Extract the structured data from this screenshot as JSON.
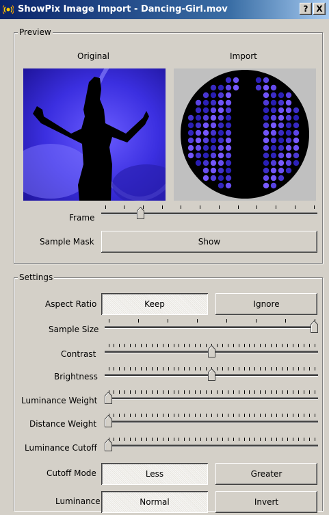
{
  "window": {
    "title": "ShowPix Image Import - Dancing-Girl.mov",
    "help_label": "?",
    "close_label": "X"
  },
  "preview": {
    "legend": "Preview",
    "original_label": "Original",
    "import_label": "Import",
    "frame_label": "Frame",
    "frame_value": 0.17,
    "sample_mask_label": "Sample Mask",
    "show_button": "Show"
  },
  "settings": {
    "legend": "Settings",
    "aspect_ratio": {
      "label": "Aspect Ratio",
      "options": [
        "Keep",
        "Ignore"
      ],
      "selected": "Keep"
    },
    "sample_size": {
      "label": "Sample Size",
      "value": 1.0
    },
    "contrast": {
      "label": "Contrast",
      "value": 0.5
    },
    "brightness": {
      "label": "Brightness",
      "value": 0.5
    },
    "luminance_weight": {
      "label": "Luminance Weight",
      "value": 0.0
    },
    "distance_weight": {
      "label": "Distance Weight",
      "value": 0.0
    },
    "luminance_cutoff": {
      "label": "Luminance Cutoff",
      "value": 0.0
    },
    "cutoff_mode": {
      "label": "Cutoff Mode",
      "options": [
        "Less",
        "Greater"
      ],
      "selected": "Less"
    },
    "luminance": {
      "label": "Luminance",
      "options": [
        "Normal",
        "Invert"
      ],
      "selected": "Normal"
    }
  },
  "colors": {
    "titlebar_start": "#0a246a",
    "titlebar_end": "#a6caf0",
    "window_bg": "#d4d0c8",
    "preview_blue": "#3b2fe0",
    "led_blue": "#4b43ff"
  }
}
